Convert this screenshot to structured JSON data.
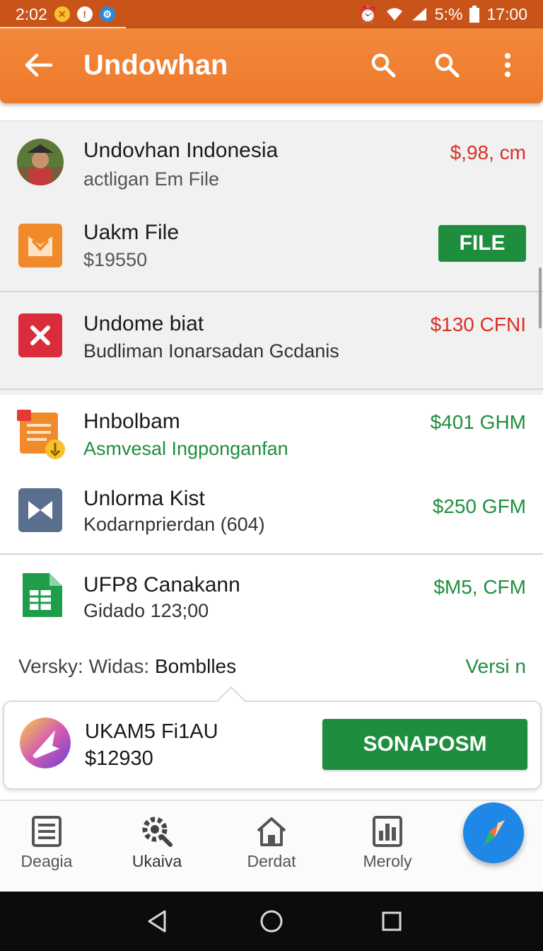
{
  "status_bar": {
    "time": "2:02",
    "battery_pct": "5:%",
    "clock_right": "17:00"
  },
  "app_bar": {
    "title": "Undowhan",
    "back_icon": "arrow-left-icon",
    "actions": [
      "search-icon",
      "search-icon",
      "more-vert-icon"
    ]
  },
  "items": [
    {
      "title": "Undovhan Indonesia",
      "subtitle": "actligan Em File",
      "price": "$,98, cm",
      "price_color": "#d93025",
      "icon": "avatar-photo"
    },
    {
      "title": "Uakm File",
      "subtitle": "$19550",
      "button": "FILE",
      "icon": "orange-m-icon"
    },
    {
      "title": "Undome biat",
      "subtitle": "Budliman Ionarsadan Gcdanis",
      "price": "$130 CFNI",
      "price_color": "#d93025",
      "icon": "red-x-icon"
    },
    {
      "title": "Hnbolbam",
      "subtitle": "Asmvesal Ingponganfan",
      "subtitle_color": "#1e8e3e",
      "price": "$401 GHM",
      "price_color": "#1e8e3e",
      "icon": "document-warning-icon"
    },
    {
      "title": "Unlorma Kist",
      "subtitle": "Kodarnprierdan (604)",
      "price": "$250 GFM",
      "price_color": "#1e8e3e",
      "icon": "bowtie-icon"
    },
    {
      "title": "UFP8 Canakann",
      "subtitle": "Gidado 123;00",
      "price": "$M5, CFM",
      "price_color": "#1e8e3e",
      "icon": "sheets-icon"
    }
  ],
  "footer": {
    "prefix": "Versky: Widas:",
    "bold": "Bomblles",
    "link": "Versi n"
  },
  "promo": {
    "title": "UKAM5 Fi1AU",
    "price": "$12930",
    "button": "SONAPOSM"
  },
  "bottom_nav": [
    {
      "label": "Deagia",
      "icon": "list-document-icon"
    },
    {
      "label": "Ukaiva",
      "icon": "gear-search-icon"
    },
    {
      "label": "Derdat",
      "icon": "home-icon"
    },
    {
      "label": "Meroly",
      "icon": "bar-chart-document-icon"
    }
  ],
  "colors": {
    "accent": "#ef7c2e",
    "status_bar": "#c8541a",
    "green": "#1e8e3e",
    "red": "#d93025",
    "fab": "#1f87e5"
  }
}
